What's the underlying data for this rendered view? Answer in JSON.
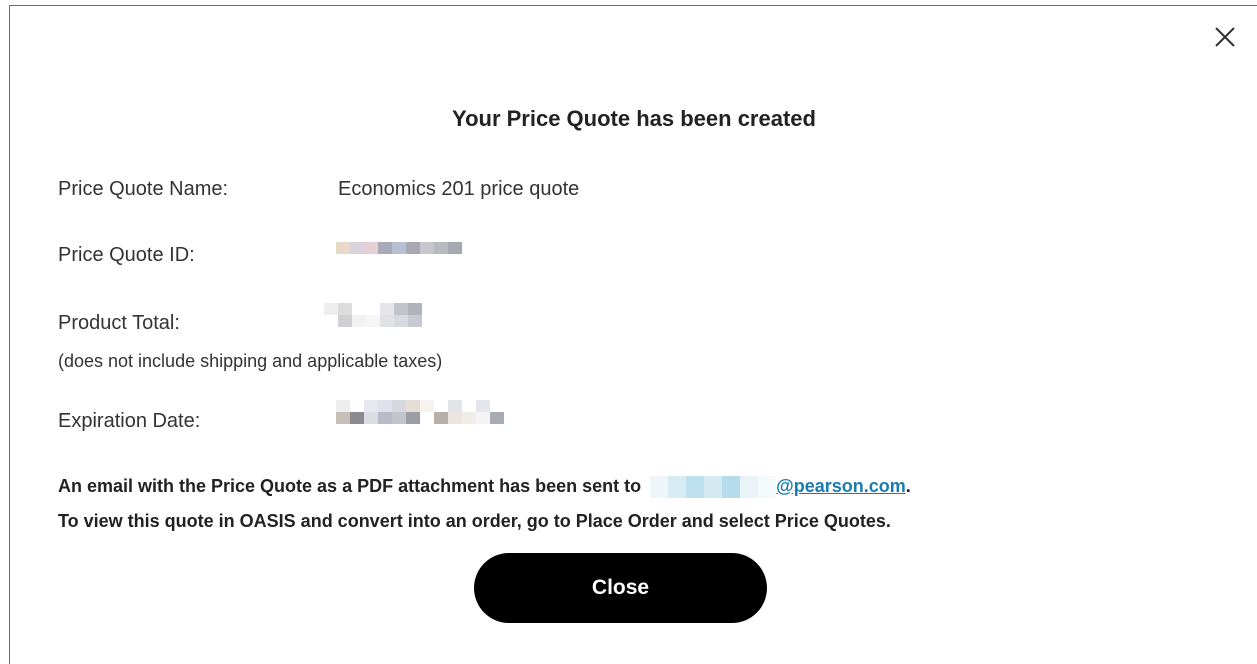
{
  "dialog": {
    "title": "Your Price Quote has been created",
    "close_icon": "close-icon",
    "fields": {
      "name_label": "Price Quote Name:",
      "name_value": "Economics 201 price quote",
      "id_label": "Price Quote ID:",
      "total_label": "Product Total:",
      "total_note": "(does not include shipping and applicable taxes)",
      "expiration_label": "Expiration Date:"
    },
    "email_message_prefix": "An email with the Price Quote as a PDF attachment has been sent to",
    "email_domain": "@pearson.com",
    "email_message_suffix": ".",
    "instruction": "To view this quote in OASIS and convert into an order, go to Place Order and select Price Quotes.",
    "close_button_label": "Close"
  },
  "colors": {
    "button_bg": "#000000",
    "link": "#1a7bb0",
    "border": "#6d6d6d"
  }
}
